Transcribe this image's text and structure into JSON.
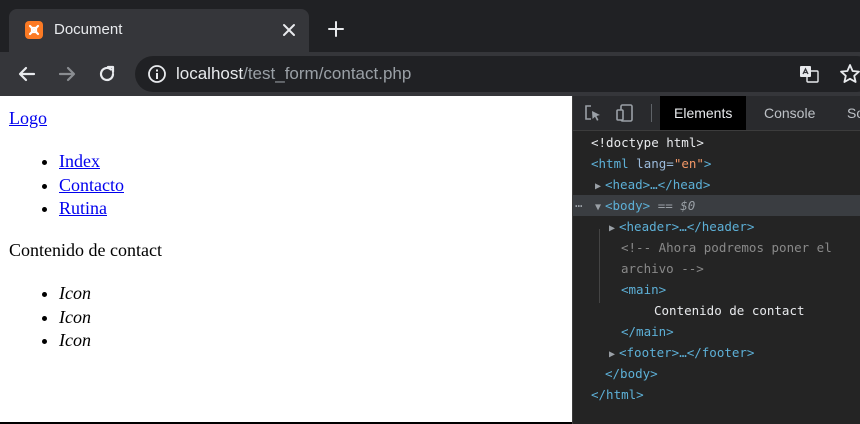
{
  "browser": {
    "tab_title": "Document",
    "url_host": "localhost",
    "url_path": "/test_form/contact.php"
  },
  "page": {
    "logo_link": "Logo",
    "nav_links": [
      "Index",
      "Contacto",
      "Rutina"
    ],
    "content_text": "Contenido de contact",
    "icon_items": [
      "Icon",
      "Icon",
      "Icon"
    ]
  },
  "devtools": {
    "tabs": [
      "Elements",
      "Console",
      "Sources"
    ],
    "active_tab": "Elements",
    "tree": {
      "doctype": "<!doctype html>",
      "html_open_tag": "<html",
      "html_lang_attr": "lang=",
      "html_lang_value": "\"en\"",
      "html_open_close": ">",
      "head_collapsed": "<head>…</head>",
      "body_open": "<body>",
      "selected_marker": "== $0",
      "header_collapsed": "<header>…</header>",
      "comment_line1": "<!-- Ahora podremos poner el",
      "comment_line2": "archivo -->",
      "main_open": "<main>",
      "main_text": "Contenido de contact",
      "main_close": "</main>",
      "footer_collapsed": "<footer>…</footer>",
      "body_close": "</body>",
      "html_close": "</html>"
    }
  },
  "colors": {
    "tag": "#5db0d7",
    "attr_value": "#f29766",
    "comment": "#898989",
    "link": "#0000ee",
    "xampp_orange": "#fb7a24"
  },
  "icons": [
    "xampp-favicon",
    "close-icon",
    "plus-icon",
    "back-arrow-icon",
    "forward-arrow-icon",
    "reload-icon",
    "info-icon",
    "translate-icon",
    "star-icon",
    "inspect-element-icon",
    "device-toggle-icon"
  ]
}
